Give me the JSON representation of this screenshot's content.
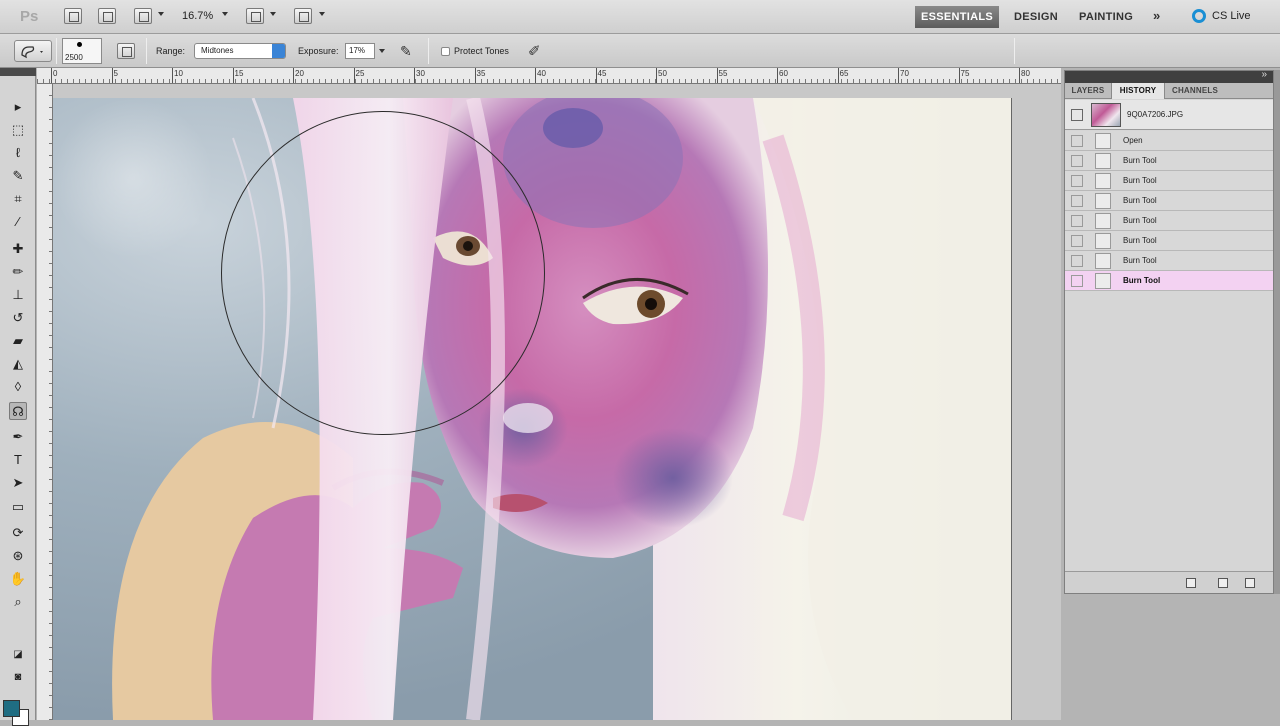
{
  "app": {
    "logo": "Ps",
    "zoom": "16.7%",
    "workspaces": {
      "essentials": "ESSENTIALS",
      "design": "DESIGN",
      "painting": "PAINTING",
      "more": "»"
    },
    "cs_live": "CS Live"
  },
  "options": {
    "brush_size": "2500",
    "range_label": "Range:",
    "range_value": "Midtones",
    "exposure_label": "Exposure:",
    "exposure_value": "17%",
    "protect_tones_label": "Protect Tones"
  },
  "tools": [
    {
      "name": "move-tool-icon",
      "glyph": "▸"
    },
    {
      "name": "marquee-tool-icon",
      "glyph": "⬚"
    },
    {
      "name": "lasso-tool-icon",
      "glyph": "ℓ"
    },
    {
      "name": "quick-select-tool-icon",
      "glyph": "✎"
    },
    {
      "name": "crop-tool-icon",
      "glyph": "⌗"
    },
    {
      "name": "eyedropper-tool-icon",
      "glyph": "⁄"
    },
    {
      "name": "healing-brush-tool-icon",
      "glyph": "✚"
    },
    {
      "name": "brush-tool-icon",
      "glyph": "✏"
    },
    {
      "name": "clone-stamp-tool-icon",
      "glyph": "⊥"
    },
    {
      "name": "history-brush-tool-icon",
      "glyph": "↺"
    },
    {
      "name": "eraser-tool-icon",
      "glyph": "▰"
    },
    {
      "name": "paint-bucket-tool-icon",
      "glyph": "◭"
    },
    {
      "name": "blur-tool-icon",
      "glyph": "◊"
    },
    {
      "name": "burn-tool-icon",
      "glyph": "☊"
    },
    {
      "name": "pen-tool-icon",
      "glyph": "✒"
    },
    {
      "name": "type-tool-icon",
      "glyph": "T"
    },
    {
      "name": "path-selection-tool-icon",
      "glyph": "➤"
    },
    {
      "name": "rectangle-tool-icon",
      "glyph": "▭"
    },
    {
      "name": "3d-rotate-tool-icon",
      "glyph": "⟳"
    },
    {
      "name": "3d-orbit-tool-icon",
      "glyph": "⊛"
    },
    {
      "name": "hand-tool-icon",
      "glyph": "✋"
    },
    {
      "name": "zoom-tool-icon",
      "glyph": "⌕"
    }
  ],
  "colors": {
    "foreground": "#1f6d82",
    "background": "#ffffff",
    "history_selected": "#f3d2f2"
  },
  "rulers": {
    "top": [
      "0",
      "5",
      "10",
      "15",
      "20",
      "25",
      "30",
      "35",
      "40",
      "45",
      "50",
      "55",
      "60",
      "65",
      "70",
      "75",
      "80"
    ]
  },
  "panel": {
    "tabs": [
      "LAYERS",
      "HISTORY",
      "CHANNELS"
    ],
    "active_tab": "HISTORY",
    "snapshot_name": "9Q0A7206.JPG",
    "history": [
      {
        "label": "Open",
        "icon": "open-document-icon"
      },
      {
        "label": "Burn Tool",
        "icon": "burn-tool-icon"
      },
      {
        "label": "Burn Tool",
        "icon": "burn-tool-icon"
      },
      {
        "label": "Burn Tool",
        "icon": "burn-tool-icon"
      },
      {
        "label": "Burn Tool",
        "icon": "burn-tool-icon"
      },
      {
        "label": "Burn Tool",
        "icon": "burn-tool-icon"
      },
      {
        "label": "Burn Tool",
        "icon": "burn-tool-icon"
      },
      {
        "label": "Burn Tool",
        "icon": "burn-tool-icon"
      }
    ],
    "selected_index": 7
  }
}
